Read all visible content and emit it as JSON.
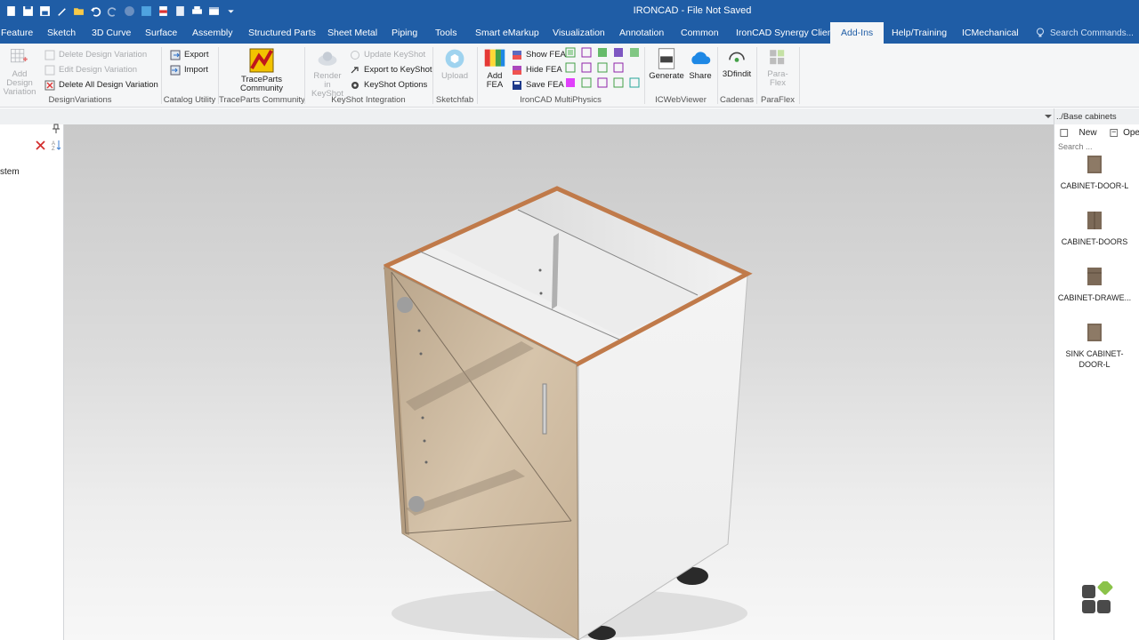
{
  "window": {
    "title": "IRONCAD - File Not Saved"
  },
  "quick_access": [
    "new-icon",
    "save-icon",
    "save-as-icon",
    "edit-icon",
    "open-icon",
    "undo-icon",
    "redo-icon",
    "globe-icon",
    "scene-icon",
    "pdf-icon",
    "document-icon",
    "print-icon",
    "layout-icon",
    "dropdown-icon"
  ],
  "menu_tabs": [
    "Feature",
    "Sketch",
    "3D Curve",
    "Surface",
    "Assembly",
    "Structured Parts",
    "Sheet Metal",
    "Piping",
    "Tools",
    "Smart eMarkup",
    "Visualization",
    "Annotation",
    "Common",
    "IronCAD Synergy Client",
    "Add-Ins",
    "Help/Training",
    "ICMechanical"
  ],
  "active_tab": "Add-Ins",
  "search_commands": "Search Commands...",
  "ribbon": {
    "design_variations": {
      "label": "DesignVariations",
      "add": "Add Design Variation",
      "delete": "Delete Design Variation",
      "edit": "Edit Design Variation",
      "delete_all": "Delete All Design Variation"
    },
    "catalog_utility": {
      "label": "Catalog Utility",
      "export": "Export",
      "import": "Import"
    },
    "traceparts": {
      "label": "TraceParts Community",
      "button": "TraceParts Community"
    },
    "keyshot": {
      "label": "KeyShot Integration",
      "render": "Render in KeyShot",
      "update": "Update KeyShot",
      "export": "Export to KeyShot",
      "options": "KeyShot Options"
    },
    "sketchfab": {
      "label": "Sketchfab",
      "upload": "Upload"
    },
    "multiphysics": {
      "label": "IronCAD MultiPhysics",
      "add_fea": "Add FEA",
      "show_fea": "Show FEA",
      "hide_fea": "Hide FEA",
      "save_fea": "Save FEA"
    },
    "icwebviewer": {
      "label": "ICWebViewer",
      "generate": "Generate",
      "share": "Share"
    },
    "cadenas": {
      "label": "Cadenas",
      "button": "3Dfindit"
    },
    "paraflex": {
      "label": "ParaFlex",
      "button": "Para-Flex"
    }
  },
  "left_panel": {
    "tree_item": "stem"
  },
  "catalog": {
    "path": "../Base cabinets",
    "new": "New",
    "open": "Ope",
    "search_placeholder": "Search ...",
    "items": [
      {
        "name": "CABINET-DOOR-L"
      },
      {
        "name": "CABINET-DOORS"
      },
      {
        "name": "CABINET-DRAWE..."
      },
      {
        "name": "SINK CABINET-DOOR-L"
      }
    ]
  },
  "colors": {
    "titlebar": "#1f5da6",
    "edge_banding": "#c07a4a",
    "wood": "#cdb79c"
  }
}
